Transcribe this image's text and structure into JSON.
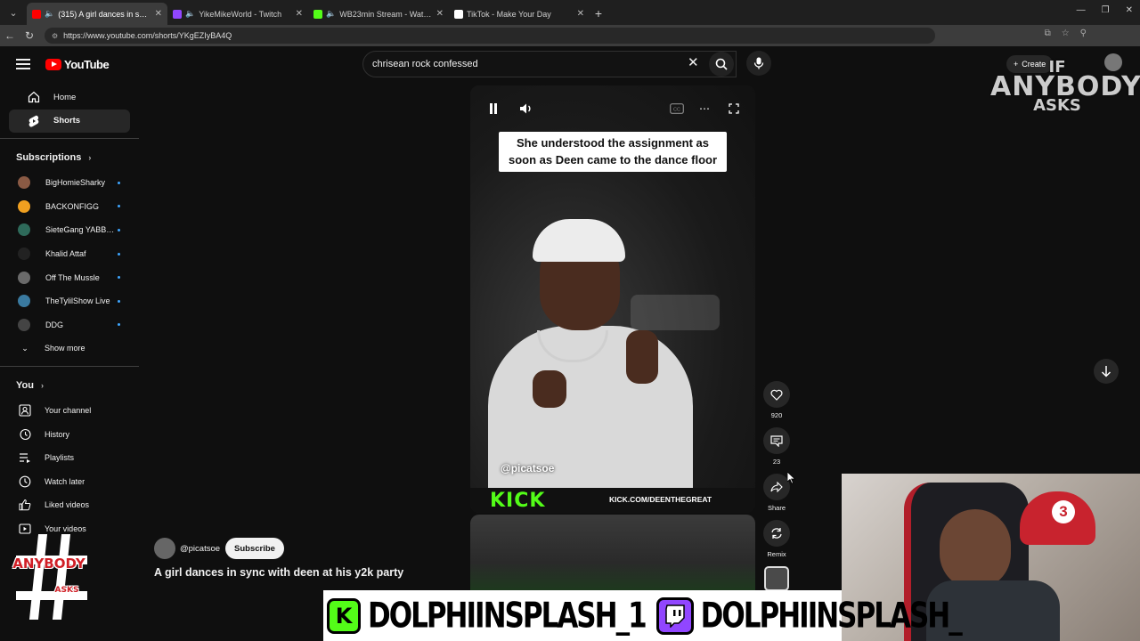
{
  "browser": {
    "tabs": [
      {
        "title": "(315) A girl dances in sync with",
        "favicon_color": "#ff0000",
        "active": true
      },
      {
        "title": "YikeMikeWorld - Twitch",
        "favicon_color": "#9146ff",
        "active": false
      },
      {
        "title": "WB23min Stream - Watch Live",
        "favicon_color": "#53fc18",
        "active": false
      },
      {
        "title": "TikTok - Make Your Day",
        "favicon_color": "#ffffff",
        "active": false
      }
    ],
    "url": "https://www.youtube.com/shorts/YKgEZIyBA4Q"
  },
  "header": {
    "logo_text": "YouTube",
    "search_value": "chrisean rock confessed",
    "create_label": "Create"
  },
  "sidebar": {
    "main": [
      {
        "label": "Home",
        "icon": "home-icon"
      },
      {
        "label": "Shorts",
        "icon": "shorts-icon",
        "active": true
      }
    ],
    "subscriptions_title": "Subscriptions",
    "subscriptions": [
      {
        "name": "BigHomieSharky",
        "color": "#8a5a44"
      },
      {
        "name": "BACKONFIGG",
        "color": "#f0a020"
      },
      {
        "name": "SieteGang YABBI...",
        "color": "#2e6a5a"
      },
      {
        "name": "Khalid Attaf",
        "color": "#222222"
      },
      {
        "name": "Off The Mussle",
        "color": "#6a6a6a"
      },
      {
        "name": "TheTylilShow Live",
        "color": "#3a7aa0"
      },
      {
        "name": "DDG",
        "color": "#444444"
      }
    ],
    "show_more": "Show more",
    "you_title": "You",
    "you_items": [
      {
        "label": "Your channel",
        "icon": "channel-icon"
      },
      {
        "label": "History",
        "icon": "history-icon"
      },
      {
        "label": "Playlists",
        "icon": "playlists-icon"
      },
      {
        "label": "Watch later",
        "icon": "watch-later-icon"
      },
      {
        "label": "Liked videos",
        "icon": "like-icon"
      },
      {
        "label": "Your videos",
        "icon": "your-videos-icon"
      }
    ]
  },
  "short": {
    "caption": "She understood the assignment as soon as Deen came to the dance floor",
    "handle_overlay": "@picatsoe",
    "kick_logo": "KICK",
    "kick_url": "KICK.COM/DEENTHEGREAT",
    "channel": "@picatsoe",
    "subscribe_label": "Subscribe",
    "title": "A girl dances in sync with deen at his y2k party"
  },
  "actions": {
    "likes": "920",
    "comments": "23",
    "share": "Share",
    "remix": "Remix"
  },
  "overlay": {
    "watermark_top": [
      "IF",
      "ANYBODY",
      "ASKS"
    ],
    "watermark_bottom": [
      "ANYBODY",
      "ASKS"
    ],
    "banner_kick": "DOLPHIINSPLASH_1",
    "banner_twitch": "DOLPHIINSPLASH_"
  }
}
